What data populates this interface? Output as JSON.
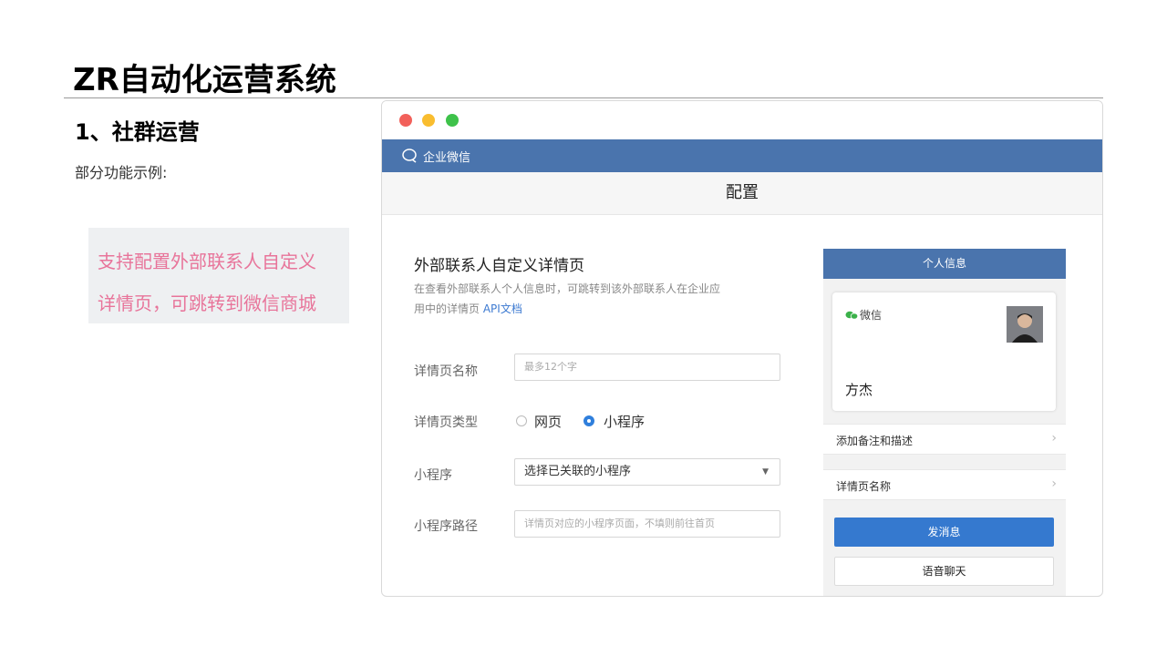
{
  "slide": {
    "title": "ZR自动化运营系统",
    "section_heading": "1、社群运营",
    "section_sub": "部分功能示例:",
    "note_lines": [
      "支持配置外部联系人自定义",
      "详情页，可跳转到微信商城"
    ]
  },
  "window": {
    "app_name": "企业微信",
    "page_title": "配置",
    "form": {
      "title": "外部联系人自定义详情页",
      "desc_line1": "在查看外部联系人个人信息时，可跳转到该外部联系人在企业应",
      "desc_line2": "用中的详情页",
      "api_link": "API文档",
      "fields": {
        "name_label": "详情页名称",
        "name_placeholder": "最多12个字",
        "type_label": "详情页类型",
        "type_options": [
          "网页",
          "小程序"
        ],
        "type_selected": "小程序",
        "miniprogram_label": "小程序",
        "miniprogram_value": "选择已关联的小程序",
        "path_label": "小程序路径",
        "path_placeholder": "详情页对应的小程序页面，不填则前往首页"
      }
    },
    "preview": {
      "header": "个人信息",
      "wechat_label": "微信",
      "contact_name": "方杰",
      "row_remark": "添加备注和描述",
      "row_detail": "详情页名称",
      "btn_message": "发消息",
      "btn_voice": "语音聊天"
    }
  },
  "colors": {
    "accent_blue": "#4a74ad",
    "button_blue": "#3579cf",
    "note_pink": "#e8749a"
  }
}
